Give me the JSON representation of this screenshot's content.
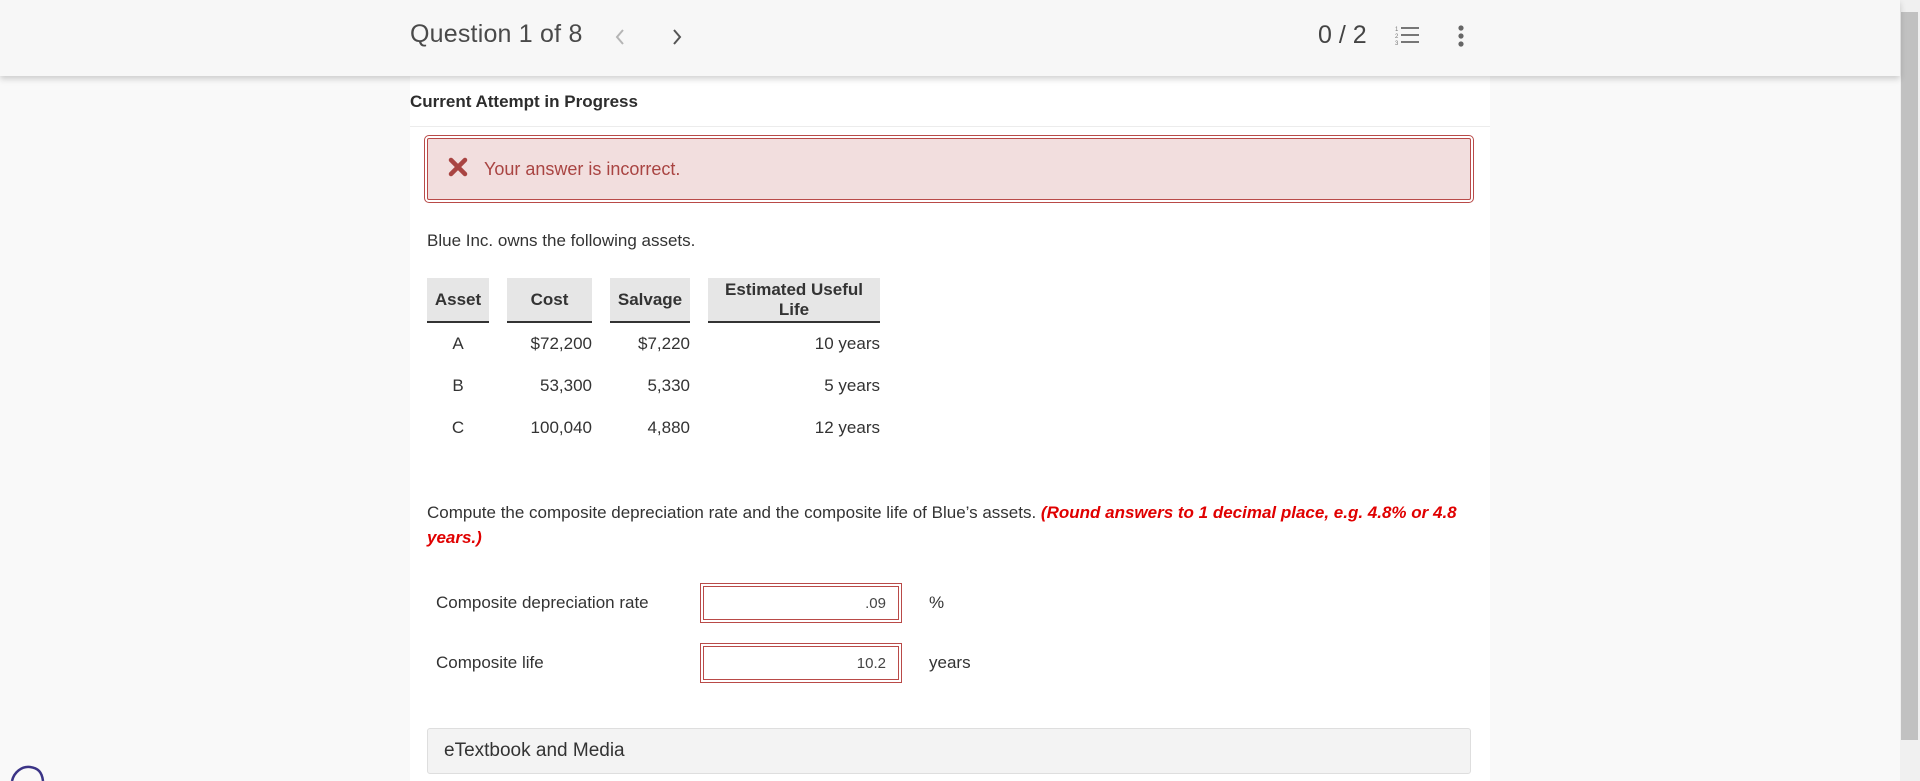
{
  "header": {
    "question_position": "Question 1 of 8",
    "prev_icon": "chevron-left-icon",
    "next_icon": "chevron-right-icon",
    "score": "0 / 2",
    "question_list_icon": "numbered-list-icon",
    "more_icon": "vertical-ellipsis-icon"
  },
  "attempt": {
    "label": "Current Attempt in Progress"
  },
  "feedback": {
    "icon": "x-icon",
    "message": "Your answer is incorrect.",
    "colors": {
      "background": "#f2dede",
      "border": "#b94a48",
      "text": "#a94442"
    }
  },
  "question": {
    "intro": "Blue Inc. owns the following assets.",
    "table": {
      "headers": [
        "Asset",
        "Cost",
        "Salvage",
        "Estimated Useful Life"
      ],
      "rows": [
        [
          "A",
          "$72,200",
          "$7,220",
          "10 years"
        ],
        [
          "B",
          "53,300",
          "5,330",
          "5 years"
        ],
        [
          "C",
          "100,040",
          "4,880",
          "12 years"
        ]
      ]
    },
    "instruction": "Compute the composite depreciation rate and the composite life of Blue’s assets. ",
    "hint": "(Round answers to 1 decimal place, e.g. 4.8% or 4.8 years.)",
    "hint_color": "#e00000"
  },
  "answers": [
    {
      "label": "Composite depreciation rate",
      "value": ".09",
      "unit": "%"
    },
    {
      "label": "Composite life",
      "value": "10.2",
      "unit": "years"
    }
  ],
  "resources": {
    "label": "eTextbook and Media"
  }
}
